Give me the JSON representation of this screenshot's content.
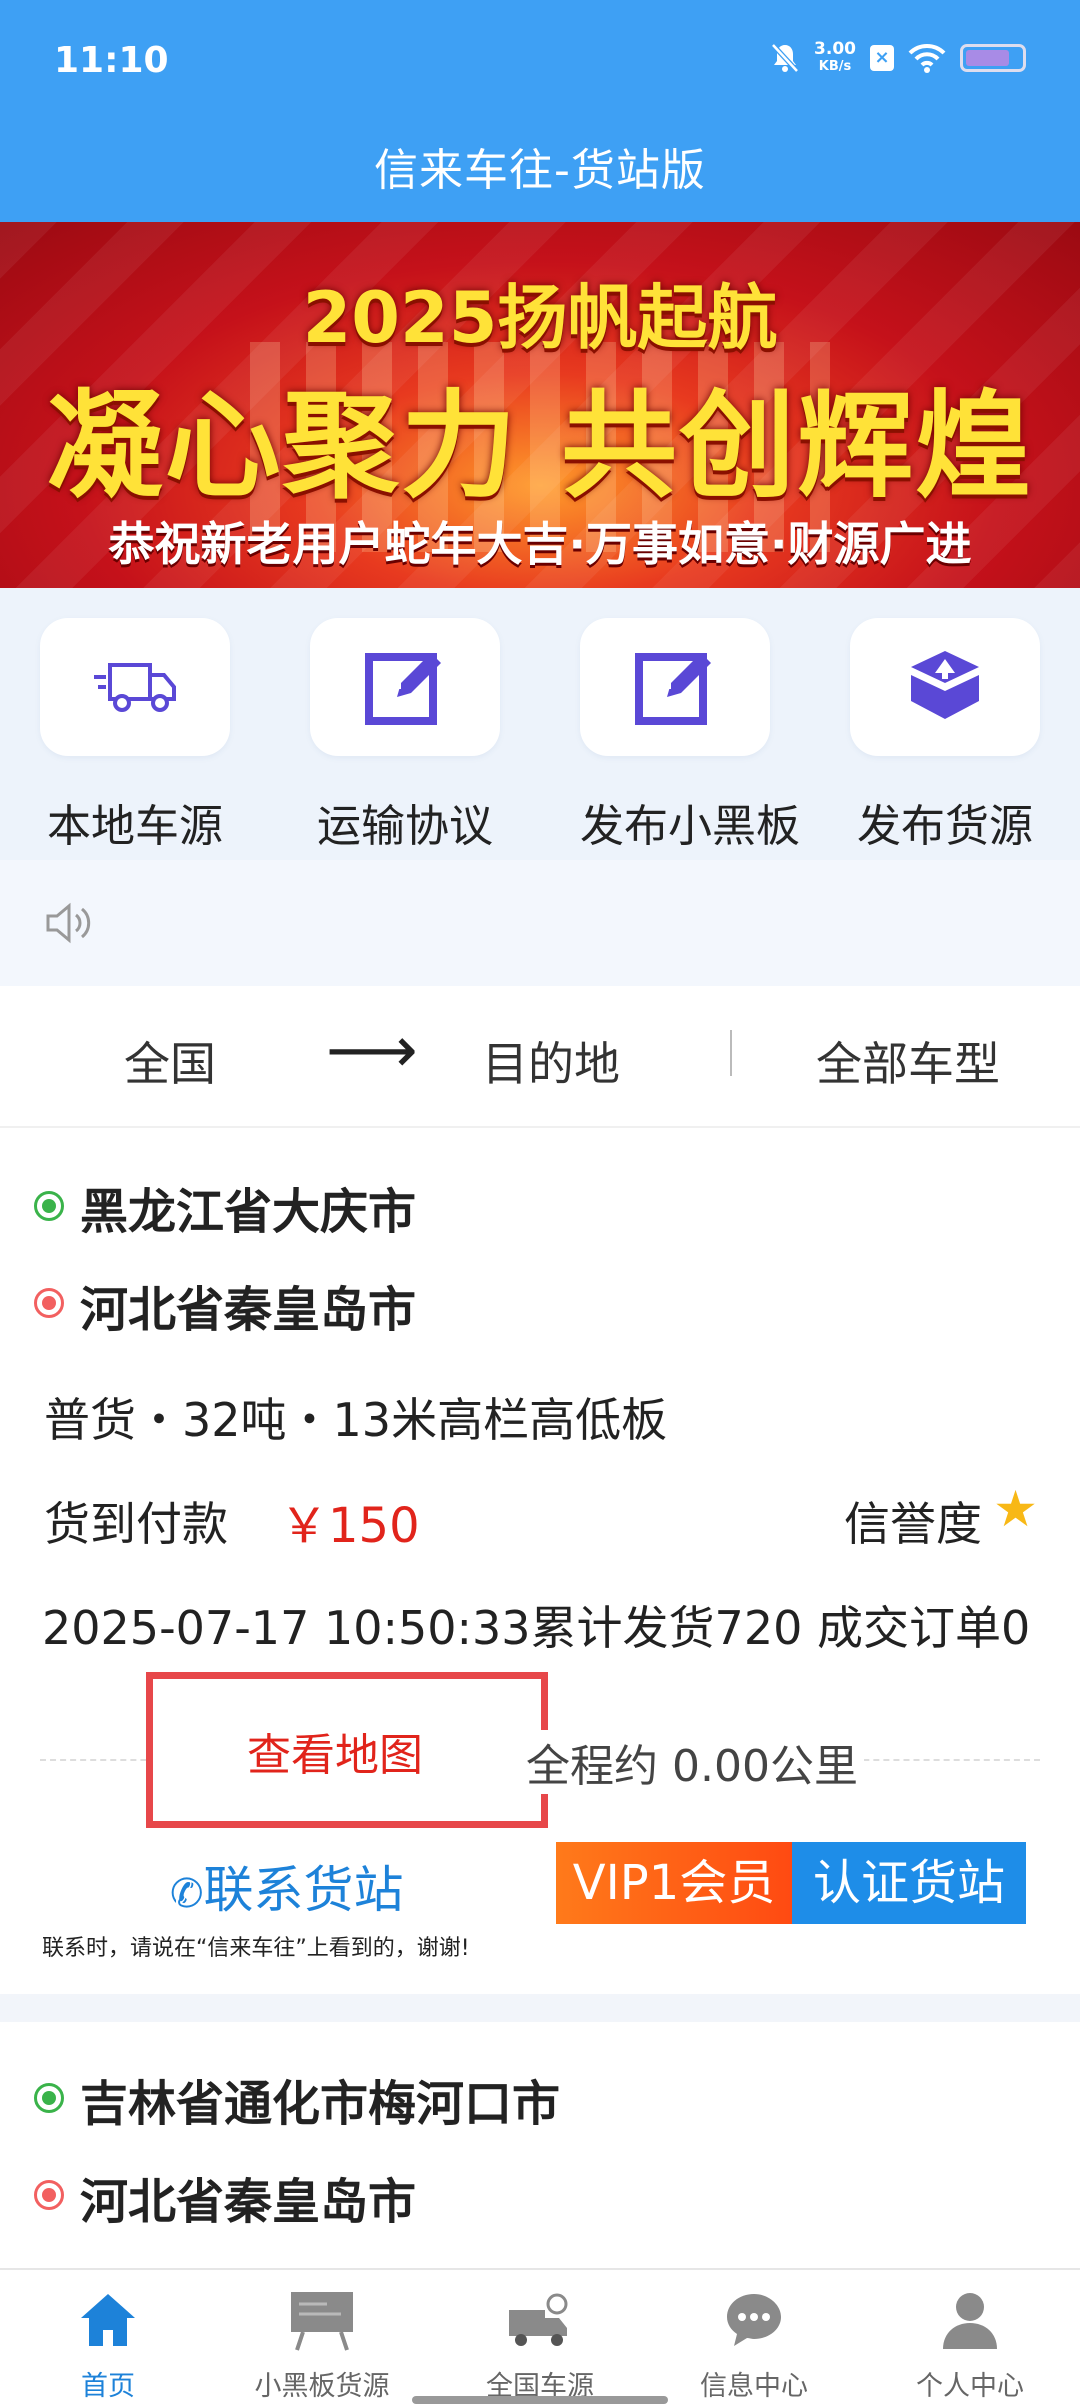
{
  "status": {
    "time": "11:10",
    "speed_value": "3.00",
    "speed_unit": "KB/s"
  },
  "app": {
    "title": "信来车往-货站版"
  },
  "banner": {
    "year_line": "2025扬帆起航",
    "main_line": "凝心聚力 共创辉煌",
    "sub_line": "恭祝新老用户蛇年大吉·万事如意·财源广进"
  },
  "actions": [
    {
      "label": "本地车源",
      "icon": "truck-icon"
    },
    {
      "label": "运输协议",
      "icon": "edit-icon"
    },
    {
      "label": "发布小黑板",
      "icon": "edit-icon"
    },
    {
      "label": "发布货源",
      "icon": "box-icon"
    }
  ],
  "filter": {
    "origin": "全国",
    "arrow": "⟶",
    "destination": "目的地",
    "vehicle_type": "全部车型"
  },
  "cargo": [
    {
      "from": "黑龙江省大庆市",
      "to": "河北省秦皇岛市",
      "detail": "普货・32吨・13米高栏高低板",
      "payment": "货到付款",
      "price": "￥150",
      "credit_label": "信誉度",
      "meta": "2025-07-17 10:50:33累计发货720 成交订单0",
      "map_button": "查看地图",
      "distance": "全程约 0.00公里",
      "contact": "联系货站",
      "vip": "VIP1会员",
      "certified": "认证货站",
      "tip": "联系时，请说在“信来车往”上看到的，谢谢!"
    },
    {
      "from": "吉林省通化市梅河口市",
      "to": "河北省秦皇岛市"
    }
  ],
  "nav": [
    {
      "label": "首页",
      "icon": "home-icon",
      "active": true
    },
    {
      "label": "小黑板货源",
      "icon": "blackboard-icon"
    },
    {
      "label": "全国车源",
      "icon": "truck-search-icon"
    },
    {
      "label": "信息中心",
      "icon": "chat-icon"
    },
    {
      "label": "个人中心",
      "icon": "user-icon"
    }
  ],
  "colors": {
    "primary": "#3ea0f4",
    "price": "#e1241b",
    "link": "#1d82d9",
    "vip": "#ff5a14",
    "certified": "#1e8de8"
  }
}
